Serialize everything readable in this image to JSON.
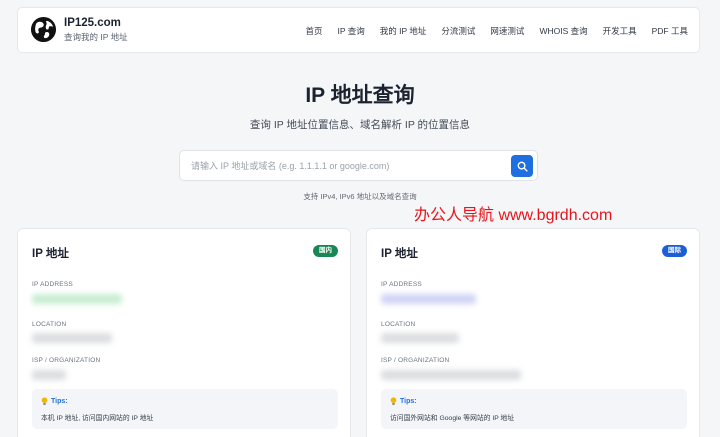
{
  "brand": {
    "name": "IP125.com",
    "subtitle": "查询我的 IP 地址"
  },
  "nav": [
    "首页",
    "IP 查询",
    "我的 IP 地址",
    "分流测试",
    "网速测试",
    "WHOIS 查询",
    "开发工具",
    "PDF 工具"
  ],
  "hero": {
    "title": "IP 地址查询",
    "subtitle": "查询 IP 地址位置信息、域名解析 IP 的位置信息"
  },
  "search": {
    "value": "",
    "placeholder": "请输入 IP 地址或域名 (e.g. 1.1.1.1 or google.com)",
    "hint": "支持 IPv4, IPv6 地址以及域名查询"
  },
  "watermark": "办公人导航 www.bgrdh.com",
  "cards": [
    {
      "title": "IP 地址",
      "badge": "国内",
      "badge_color": "#198754",
      "ip_label": "IP ADDRESS",
      "location_label": "LOCATION",
      "isp_label": "ISP / ORGANIZATION",
      "tips_title": "Tips:",
      "tips_text": "本机 IP 地址, 访问国内网站的 IP 地址"
    },
    {
      "title": "IP 地址",
      "badge": "国际",
      "badge_color": "#1c5fd4",
      "ip_label": "IP ADDRESS",
      "location_label": "LOCATION",
      "isp_label": "ISP / ORGANIZATION",
      "tips_title": "Tips:",
      "tips_text": "访问国外网站和 Google 等网站的 IP 地址"
    }
  ],
  "colors": {
    "primary": "#1f6fe0",
    "watermark": "#e8141b",
    "background": "#f5f6f8"
  }
}
